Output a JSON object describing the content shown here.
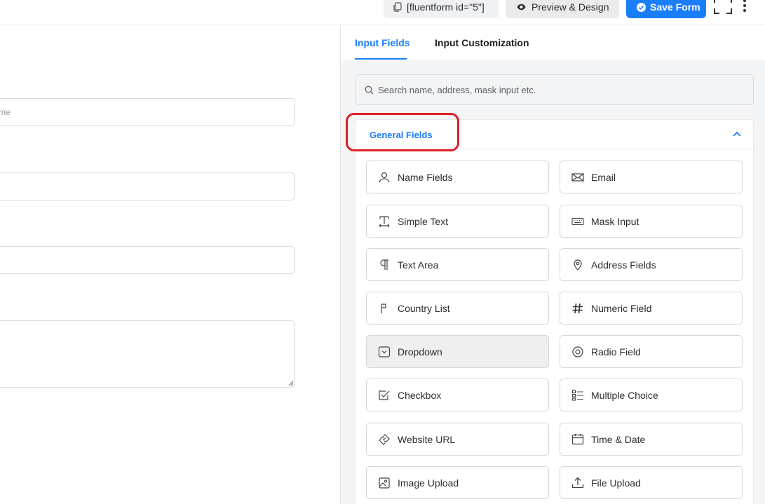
{
  "toolbar": {
    "shortcode_label": "[fluentform id=\"5\"]",
    "preview_label": "Preview & Design",
    "save_label": "Save Form"
  },
  "editor": {
    "first_input_placeholder": "me"
  },
  "panel": {
    "tabs": [
      {
        "label": "Input Fields",
        "active": true
      },
      {
        "label": "Input Customization",
        "active": false
      }
    ],
    "search_placeholder": "Search name, address, mask input etc.",
    "section_title": "General Fields",
    "fields": [
      {
        "label": "Name Fields",
        "icon": "user-icon"
      },
      {
        "label": "Email",
        "icon": "envelope-icon"
      },
      {
        "label": "Simple Text",
        "icon": "text-cursor-icon"
      },
      {
        "label": "Mask Input",
        "icon": "keyboard-icon"
      },
      {
        "label": "Text Area",
        "icon": "paragraph-icon"
      },
      {
        "label": "Address Fields",
        "icon": "map-pin-icon"
      },
      {
        "label": "Country List",
        "icon": "flag-icon"
      },
      {
        "label": "Numeric Field",
        "icon": "hash-icon"
      },
      {
        "label": "Dropdown",
        "icon": "dropdown-icon"
      },
      {
        "label": "Radio Field",
        "icon": "radio-icon"
      },
      {
        "label": "Checkbox",
        "icon": "checkbox-icon"
      },
      {
        "label": "Multiple Choice",
        "icon": "list-icon"
      },
      {
        "label": "Website URL",
        "icon": "link-icon"
      },
      {
        "label": "Time & Date",
        "icon": "calendar-icon"
      },
      {
        "label": "Image Upload",
        "icon": "image-icon"
      },
      {
        "label": "File Upload",
        "icon": "upload-icon"
      }
    ]
  },
  "colors": {
    "accent": "#1a7efb",
    "highlight": "#e11d25"
  }
}
